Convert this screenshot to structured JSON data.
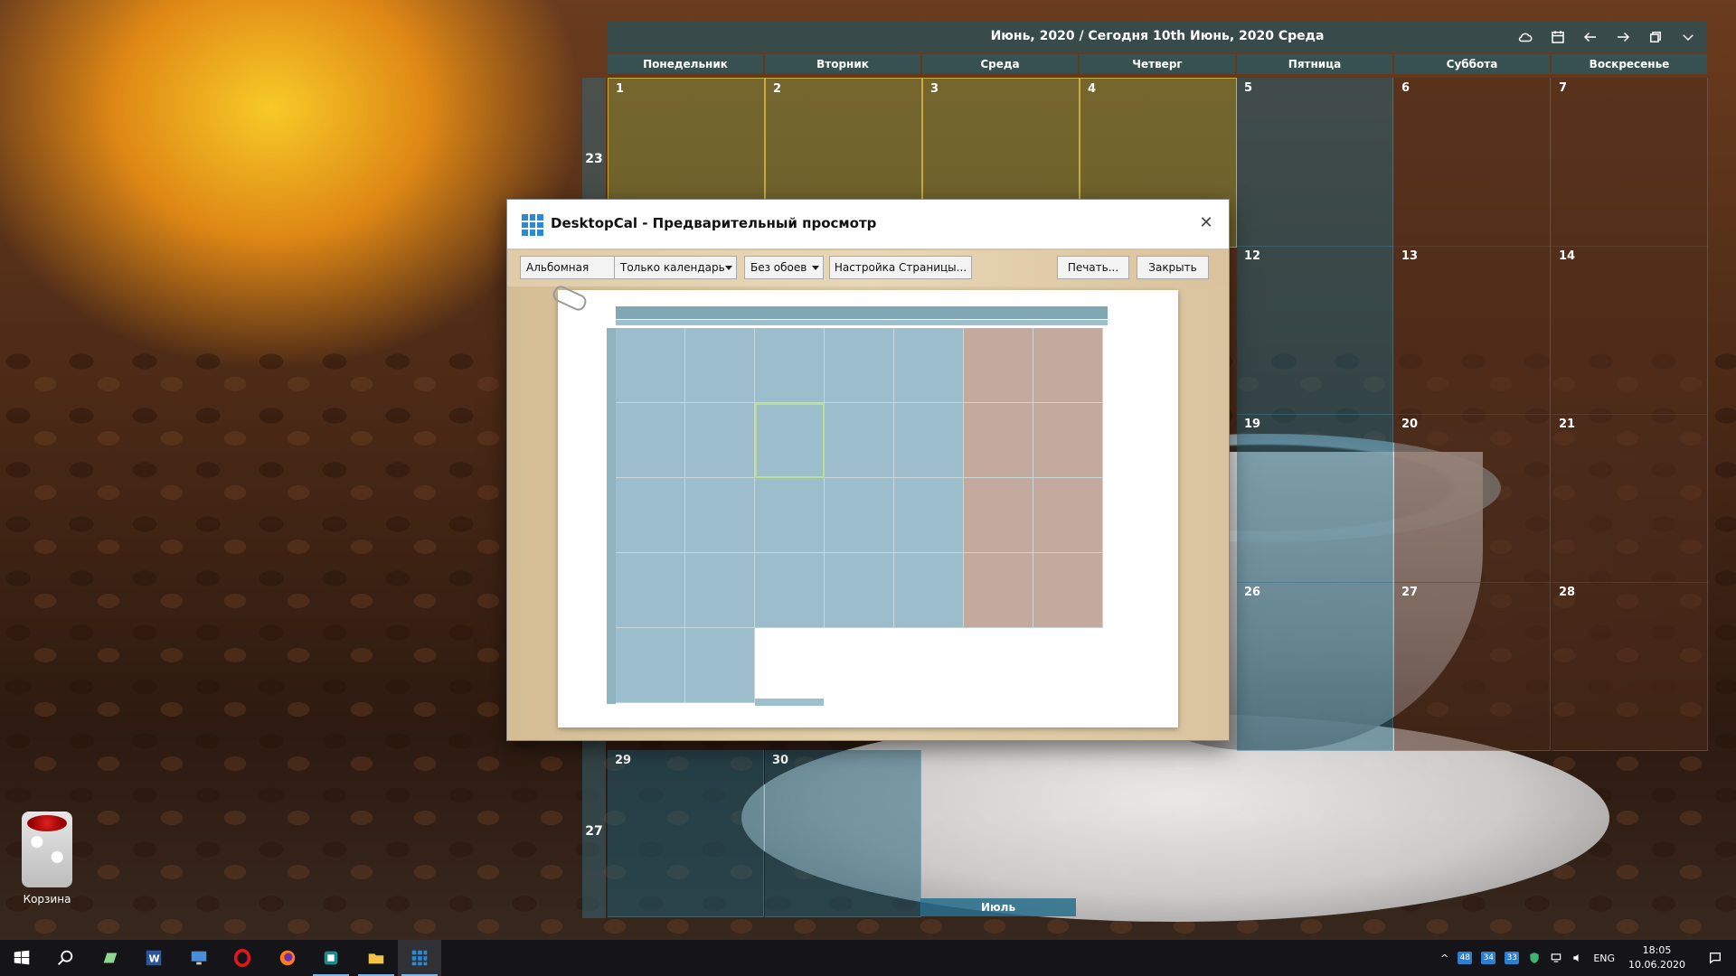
{
  "calendar": {
    "header_title": "Июнь, 2020 / Сегодня 10th Июнь, 2020 Среда",
    "weekdays": [
      "Понедельник",
      "Вторник",
      "Среда",
      "Четверг",
      "Пятница",
      "Суббота",
      "Воскресенье"
    ],
    "week_numbers": [
      "23",
      "27"
    ],
    "days_visible": [
      "1",
      "2",
      "3",
      "4",
      "5",
      "6",
      "7",
      "12",
      "13",
      "14",
      "19",
      "20",
      "21",
      "26",
      "27",
      "28",
      "29",
      "30"
    ],
    "next_month_label": "Июль"
  },
  "desktop": {
    "recycle_bin_label": "Корзина"
  },
  "dialog": {
    "title": "DesktopCal - Предварительный просмотр",
    "orientation_value": "Альбомная",
    "content_value": "Только календарь",
    "wallpaper_value": "Без обоев",
    "page_setup_label": "Настройка Страницы...",
    "print_label": "Печать...",
    "close_label": "Закрыть"
  },
  "taskbar": {
    "language": "ENG",
    "time": "18:05",
    "date": "10.06.2020",
    "tray_badges": [
      "48",
      "34",
      "33"
    ]
  },
  "colors": {
    "calendar_header": "#28505a",
    "weekday_cell": "#1e5f78",
    "weekend_cell": "#502d1e",
    "highlight_cell": "#96be50",
    "dialog_bg": "#d8c39f",
    "taskbar_bg": "#141418"
  },
  "icons": [
    "cloud-icon",
    "calendar-icon",
    "arrow-left-icon",
    "arrow-right-icon",
    "restore-window-icon",
    "chevron-down-icon",
    "close-icon",
    "windows-start-icon",
    "search-icon",
    "notepad-icon",
    "word-icon",
    "monitor-icon",
    "opera-icon",
    "firefox-icon",
    "app-icon",
    "explorer-icon",
    "desktopcal-icon",
    "notification-icon"
  ]
}
